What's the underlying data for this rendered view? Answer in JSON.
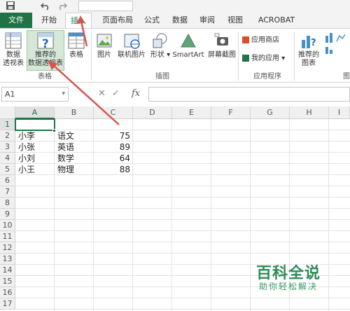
{
  "quick_access": {
    "save_icon": "save-icon",
    "undo_icon": "undo-icon",
    "redo_icon": "redo-icon"
  },
  "tabs": [
    "文件",
    "开始",
    "插入",
    "页面布局",
    "公式",
    "数据",
    "审阅",
    "视图",
    "ACROBAT"
  ],
  "active_tab": "插入",
  "ribbon": {
    "pivot_table": "数据\n透视表",
    "recommended_pivot": "推荐的\n数据透视表",
    "table": "表格",
    "group_tables": "表格",
    "picture": "图片",
    "online_picture": "联机图片",
    "shapes": "形状",
    "smartart": "SmartArt",
    "screenshot": "屏幕截图",
    "group_illustrations": "插图",
    "app_store": "应用商店",
    "my_apps": "我的应用",
    "group_apps": "应用程序",
    "recommended_charts": "推荐的\n图表",
    "group_charts": "图"
  },
  "formula_bar": {
    "name_box": "A1",
    "cancel": "✕",
    "enter": "✓",
    "fx": "fx"
  },
  "columns": [
    "A",
    "B",
    "C",
    "D",
    "E",
    "F",
    "G",
    "H",
    "I"
  ],
  "row_numbers": [
    "1",
    "2",
    "3",
    "4",
    "5",
    "6",
    "7",
    "8",
    "9",
    "10",
    "11",
    "12",
    "13",
    "14",
    "15",
    "16",
    "17"
  ],
  "rows": [
    {
      "name": "小李",
      "subject": "语文",
      "score": "75"
    },
    {
      "name": "小张",
      "subject": "英语",
      "score": "89"
    },
    {
      "name": "小刘",
      "subject": "数学",
      "score": "64"
    },
    {
      "name": "小王",
      "subject": "物理",
      "score": "88"
    }
  ],
  "watermark": {
    "title": "百科全说",
    "subtitle": "助你轻松解决"
  },
  "colors": {
    "excel_green": "#217346",
    "arrow_red": "#d9534f"
  }
}
